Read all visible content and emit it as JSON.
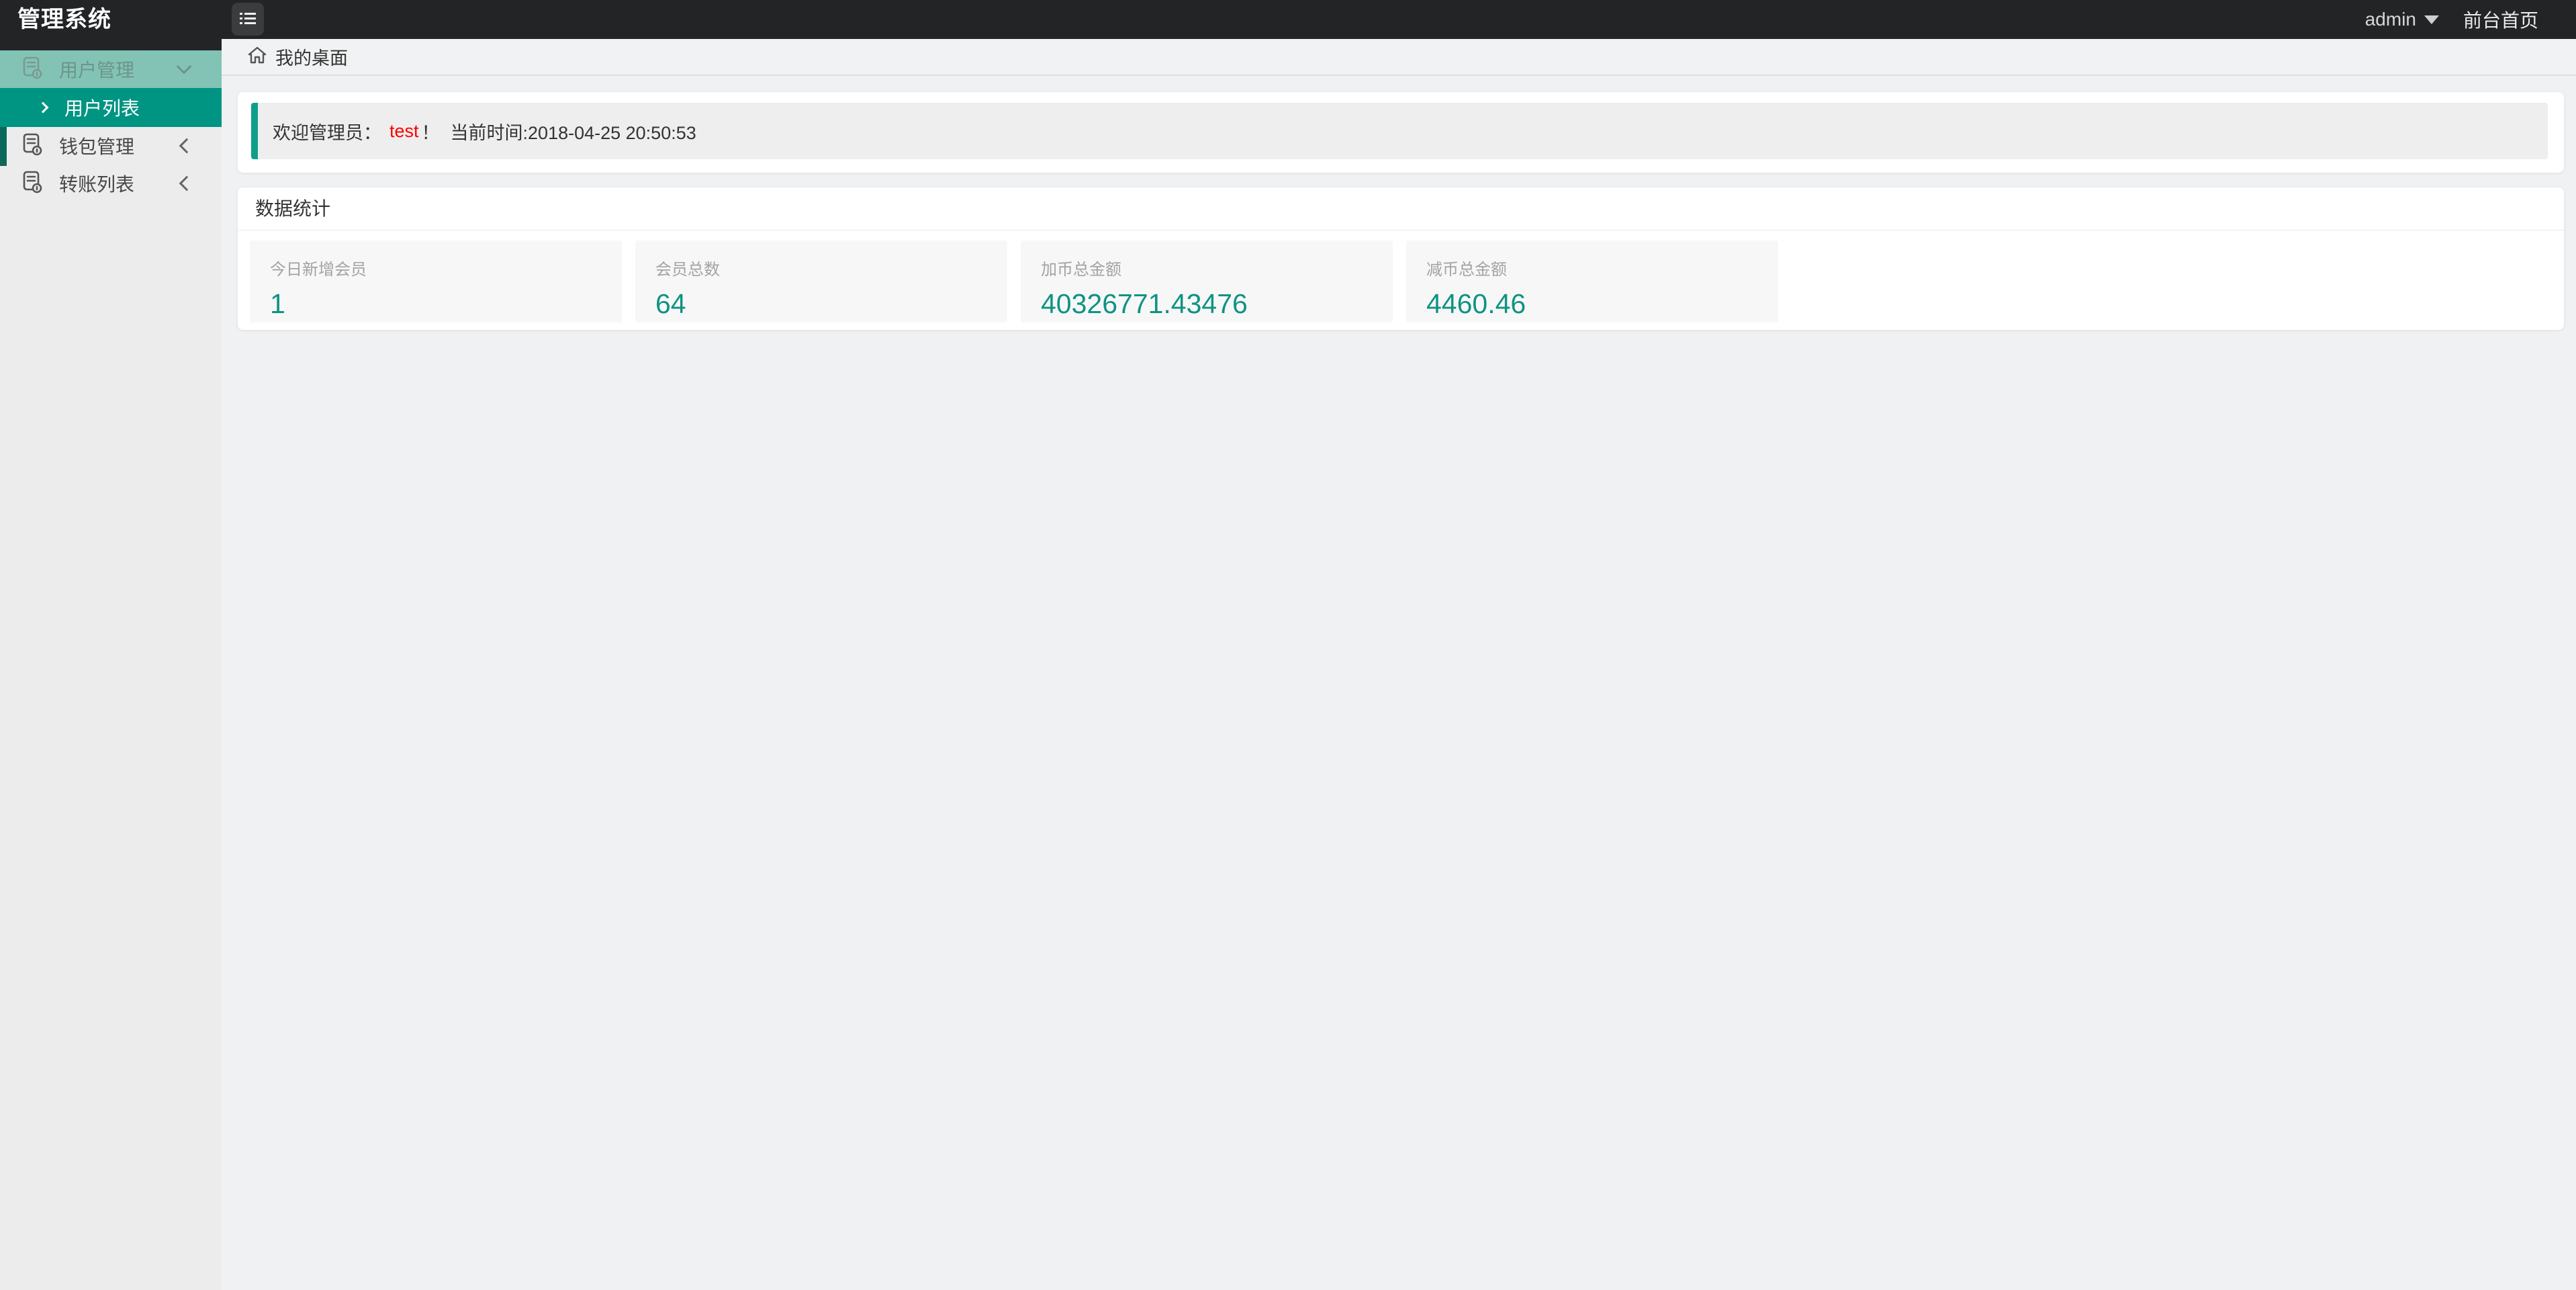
{
  "header": {
    "title": "管理系统",
    "menu_toggle_icon": "list-icon",
    "user": {
      "name": "admin",
      "caret_icon": "caret-down-icon"
    },
    "frontend_link": "前台首页"
  },
  "sidebar": {
    "groups": [
      {
        "label": "用户管理",
        "icon": "document-icon",
        "state_icon": "chevron-down-icon",
        "expanded": true,
        "children": [
          {
            "label": "用户列表",
            "icon": "chevron-right-icon",
            "active": true
          }
        ]
      },
      {
        "label": "钱包管理",
        "icon": "document-icon",
        "state_icon": "chevron-left-icon",
        "expanded": false
      },
      {
        "label": "转账列表",
        "icon": "document-icon",
        "state_icon": "chevron-left-icon",
        "expanded": false
      }
    ]
  },
  "breadcrumb": {
    "icon": "home-icon",
    "title": "我的桌面"
  },
  "welcome": {
    "prefix": "欢迎管理员：",
    "username": "test",
    "bang": "！",
    "time_text": "当前时间:2018-04-25 20:50:53"
  },
  "stats": {
    "section_title": "数据统计",
    "cards": [
      {
        "label": "今日新增会员",
        "value": "1"
      },
      {
        "label": "会员总数",
        "value": "64"
      },
      {
        "label": "加币总金额",
        "value": "40326771.43476"
      },
      {
        "label": "减币总金额",
        "value": "4460.46"
      }
    ]
  },
  "colors": {
    "header_bg": "#222426",
    "accent_teal": "#009482",
    "accent_light_teal": "#82c3b6",
    "accent_dark_stripe": "#0d685b",
    "alert_border": "#0f9e8a",
    "stat_value": "#0e9382",
    "username_red": "#ff0000"
  }
}
